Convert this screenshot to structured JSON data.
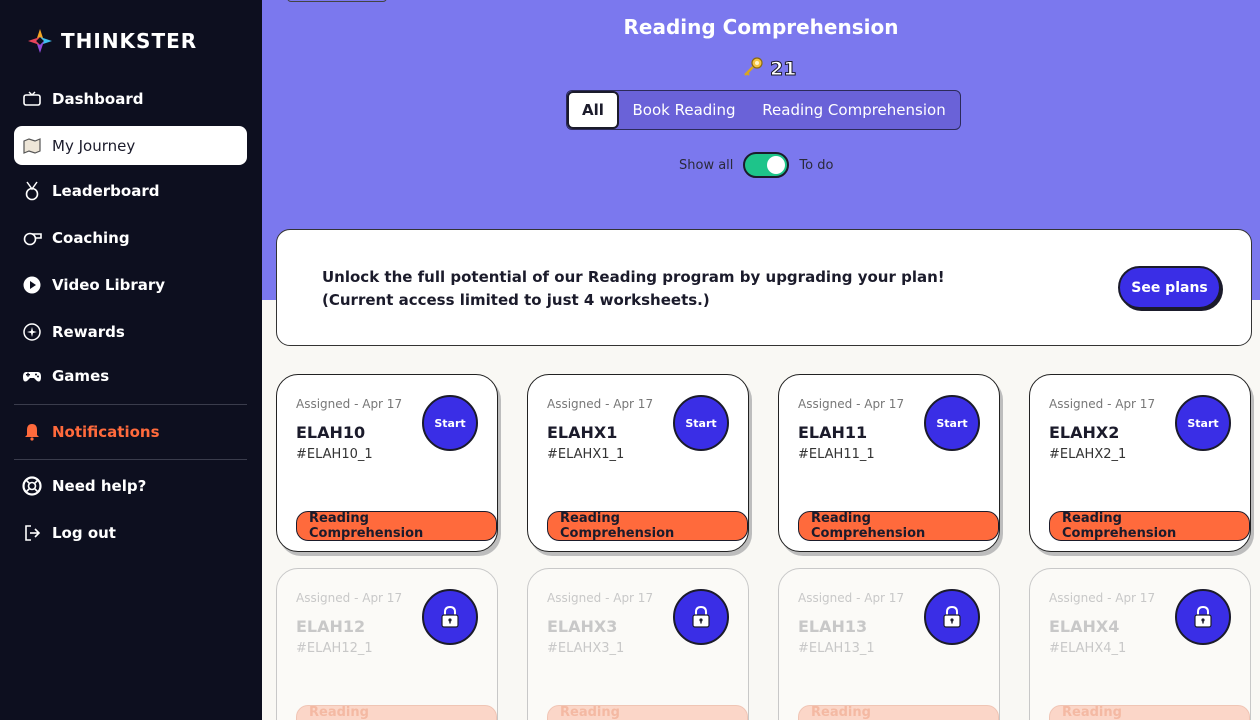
{
  "brand": {
    "name": "THINKSTER"
  },
  "sidebar": {
    "items": [
      {
        "label": "Dashboard",
        "icon": "tv-icon"
      },
      {
        "label": "My Journey",
        "icon": "map-icon"
      },
      {
        "label": "Leaderboard",
        "icon": "medal-icon"
      },
      {
        "label": "Coaching",
        "icon": "whistle-icon"
      },
      {
        "label": "Video Library",
        "icon": "play-icon"
      },
      {
        "label": "Rewards",
        "icon": "sparkle-icon"
      },
      {
        "label": "Games",
        "icon": "gamepad-icon"
      },
      {
        "label": "Notifications",
        "icon": "bell-icon"
      },
      {
        "label": "Need help?",
        "icon": "lifebuoy-icon"
      },
      {
        "label": "Log out",
        "icon": "logout-icon"
      }
    ],
    "active": "My Journey"
  },
  "header": {
    "title": "Reading Comprehension",
    "keys_count": "21",
    "tabs": [
      "All",
      "Book Reading",
      "Reading Comprehension"
    ],
    "active_tab": "All",
    "toggle": {
      "left_label": "Show all",
      "right_label": "To do",
      "on": true
    }
  },
  "banner": {
    "line1": "Unlock the full potential of our Reading program by upgrading your plan!",
    "line2": "(Current access limited to just 4 worksheets.)",
    "button": "See plans"
  },
  "cards": [
    {
      "meta": "Assigned - Apr 17",
      "name": "ELAH10",
      "code": "#ELAH10_1",
      "tag": "Reading Comprehension",
      "action": "Start",
      "locked": false
    },
    {
      "meta": "Assigned - Apr 17",
      "name": "ELAHX1",
      "code": "#ELAHX1_1",
      "tag": "Reading Comprehension",
      "action": "Start",
      "locked": false
    },
    {
      "meta": "Assigned - Apr 17",
      "name": "ELAH11",
      "code": "#ELAH11_1",
      "tag": "Reading Comprehension",
      "action": "Start",
      "locked": false
    },
    {
      "meta": "Assigned - Apr 17",
      "name": "ELAHX2",
      "code": "#ELAHX2_1",
      "tag": "Reading Comprehension",
      "action": "Start",
      "locked": false
    },
    {
      "meta": "Assigned - Apr 17",
      "name": "ELAH12",
      "code": "#ELAH12_1",
      "tag": "Reading Comprehension",
      "action": "lock-icon",
      "locked": true
    },
    {
      "meta": "Assigned - Apr 17",
      "name": "ELAHX3",
      "code": "#ELAHX3_1",
      "tag": "Reading Comprehension",
      "action": "lock-icon",
      "locked": true
    },
    {
      "meta": "Assigned - Apr 17",
      "name": "ELAH13",
      "code": "#ELAH13_1",
      "tag": "Reading Comprehension",
      "action": "lock-icon",
      "locked": true
    },
    {
      "meta": "Assigned - Apr 17",
      "name": "ELAHX4",
      "code": "#ELAHX4_1",
      "tag": "Reading Comprehension",
      "action": "lock-icon",
      "locked": true
    }
  ],
  "colors": {
    "sidebar": "#0d0f1f",
    "header": "#7b78ee",
    "primary": "#3a2ee6",
    "tag": "#ff6a3c",
    "toggle": "#1ec48a"
  }
}
